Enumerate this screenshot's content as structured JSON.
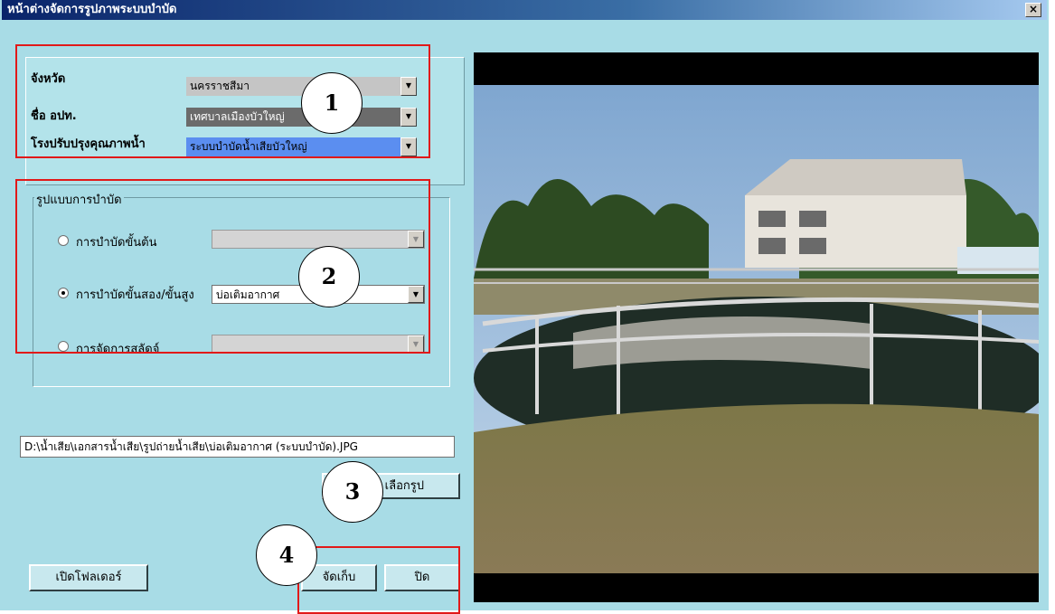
{
  "window": {
    "title": "หน้าต่างจัดการรูปภาพระบบบำบัด",
    "close_label": "×"
  },
  "location": {
    "province_label": "จังหวัด",
    "province_value": "นครราชสีมา",
    "org_label": "ชื่อ อปท.",
    "org_value": "เทศบาลเมืองบัวใหญ่",
    "plant_label": "โรงปรับปรุงคุณภาพน้ำ",
    "plant_value": "ระบบบำบัดน้ำเสียบัวใหญ่"
  },
  "treatment": {
    "group_label": "รูปแบบการบำบัด",
    "options": [
      {
        "label": "การบำบัดขั้นต้น",
        "selected": false,
        "value": ""
      },
      {
        "label": "การบำบัดขั้นสอง/ขั้นสูง",
        "selected": true,
        "value": "บ่อเติมอากาศ"
      },
      {
        "label": "การจัดการสลัดจ์",
        "selected": false,
        "value": ""
      }
    ]
  },
  "file": {
    "path": "D:\\น้ำเสีย\\เอกสารน้ำเสีย\\รูปถ่ายน้ำเสีย\\บ่อเติมอากาศ (ระบบบำบัด).JPG",
    "select_button": "เลือกรูป"
  },
  "footer": {
    "open_folder_button": "เปิดโฟลเดอร์",
    "save_button": "จัดเก็บ",
    "close_button": "ปิด"
  },
  "annotations": [
    "1",
    "2",
    "3",
    "4"
  ],
  "colors": {
    "highlight_red": "#e11919",
    "window_bg": "#a8dce6",
    "selected_combo": "#5b8ef0"
  }
}
